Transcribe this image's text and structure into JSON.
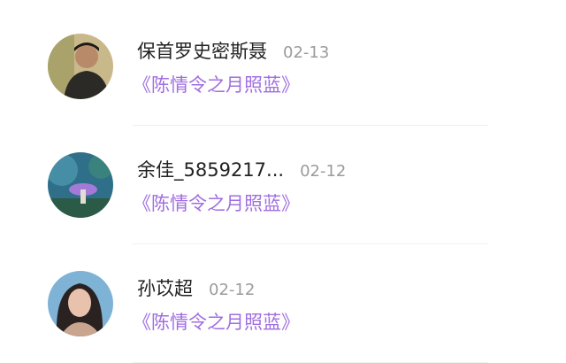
{
  "items": [
    {
      "name": "保首罗史密斯聂",
      "date": "02-13",
      "work": "《陈情令之月照蓝》"
    },
    {
      "name": "余佳_5859217...",
      "date": "02-12",
      "work": "《陈情令之月照蓝》"
    },
    {
      "name": "孙苡超",
      "date": "02-12",
      "work": "《陈情令之月照蓝》"
    }
  ],
  "colors": {
    "work_link": "#a06fe0",
    "name_text": "#222222",
    "date_text": "#9b9b9b"
  }
}
